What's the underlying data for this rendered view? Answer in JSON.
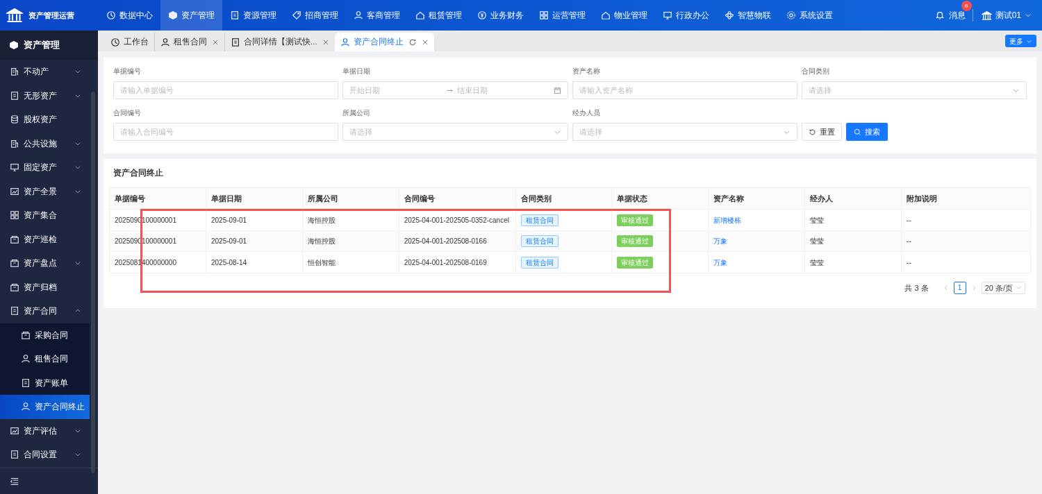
{
  "app": {
    "title": "资产管理运营"
  },
  "top_nav": [
    {
      "label": "数据中心",
      "selected": false
    },
    {
      "label": "资产管理",
      "selected": true
    },
    {
      "label": "资源管理",
      "selected": false
    },
    {
      "label": "招商管理",
      "selected": false
    },
    {
      "label": "客商管理",
      "selected": false
    },
    {
      "label": "租赁管理",
      "selected": false
    },
    {
      "label": "业务财务",
      "selected": false
    },
    {
      "label": "运营管理",
      "selected": false
    },
    {
      "label": "物业管理",
      "selected": false
    },
    {
      "label": "行政办公",
      "selected": false
    },
    {
      "label": "智慧物联",
      "selected": false
    },
    {
      "label": "系统设置",
      "selected": false
    }
  ],
  "header_right": {
    "messages": "消息",
    "message_count": "6",
    "user": "测试01"
  },
  "sidebar": {
    "title": "资产管理",
    "items": [
      {
        "label": "不动产",
        "kind": "group",
        "expanded": false,
        "selected": false
      },
      {
        "label": "无形资产",
        "kind": "group",
        "expanded": false,
        "selected": false
      },
      {
        "label": "股权资产",
        "kind": "link",
        "selected": false
      },
      {
        "label": "公共设施",
        "kind": "group",
        "expanded": false,
        "selected": false
      },
      {
        "label": "固定资产",
        "kind": "group",
        "expanded": false,
        "selected": false
      },
      {
        "label": "资产全景",
        "kind": "group",
        "expanded": false,
        "selected": false
      },
      {
        "label": "资产集合",
        "kind": "link",
        "selected": false
      },
      {
        "label": "资产巡检",
        "kind": "link",
        "selected": false
      },
      {
        "label": "资产盘点",
        "kind": "group",
        "expanded": false,
        "selected": false
      },
      {
        "label": "资产归档",
        "kind": "link",
        "selected": false
      },
      {
        "label": "资产合同",
        "kind": "group",
        "expanded": true,
        "selected": false,
        "children": [
          {
            "label": "采购合同",
            "selected": false
          },
          {
            "label": "租售合同",
            "selected": false
          },
          {
            "label": "资产账单",
            "selected": false
          },
          {
            "label": "资产合同终止",
            "selected": true
          }
        ]
      },
      {
        "label": "资产评估",
        "kind": "group",
        "expanded": false,
        "selected": false
      },
      {
        "label": "合同设置",
        "kind": "group",
        "expanded": false,
        "selected": false
      }
    ]
  },
  "tabs": [
    {
      "label": "工作台",
      "selected": false,
      "closable": false
    },
    {
      "label": "租售合同",
      "selected": false,
      "closable": true
    },
    {
      "label": "合同详情【测试快...",
      "selected": false,
      "closable": true
    },
    {
      "label": "资产合同终止",
      "selected": true,
      "closable": true
    }
  ],
  "more_button": "更多",
  "filters": [
    {
      "label": "单据编号",
      "kind": "text",
      "placeholder": "请输入单据编号"
    },
    {
      "label": "单据日期",
      "kind": "daterange",
      "placeholder": "开始日期",
      "placeholder_end": "结束日期"
    },
    {
      "label": "资产名称",
      "kind": "text",
      "placeholder": "请输入资产名称"
    },
    {
      "label": "合同类别",
      "kind": "select",
      "placeholder": "请选择"
    },
    {
      "label": "合同编号",
      "kind": "text",
      "placeholder": "请输入合同编号"
    },
    {
      "label": "所属公司",
      "kind": "select",
      "placeholder": "请选择"
    },
    {
      "label": "经办人员",
      "kind": "select",
      "placeholder": "请选择"
    }
  ],
  "buttons": {
    "reset": "重置",
    "search": "搜索"
  },
  "table": {
    "title": "资产合同终止",
    "columns": [
      "单据编号",
      "单据日期",
      "所属公司",
      "合同编号",
      "合同类别",
      "单据状态",
      "资产名称",
      "经办人",
      "附加说明"
    ],
    "rows": [
      [
        "2025090100000001",
        "2025-09-01",
        "海恒控股",
        "2025-04-001-202505-0352-cancel",
        "租赁合同",
        "审核通过",
        "新增楼栋",
        "莹莹",
        "--"
      ],
      [
        "2025090100000001",
        "2025-09-01",
        "海恒控股",
        "2025-04-001-202508-0166",
        "租赁合同",
        "审核通过",
        "万象",
        "莹莹",
        "--"
      ],
      [
        "2025081400000000",
        "2025-08-14",
        "恒创智能",
        "2025-04-001-202508-0169",
        "租赁合同",
        "审核通过",
        "万象",
        "莹莹",
        "--"
      ]
    ]
  },
  "pagination": {
    "total": "共 3 条",
    "pages": [
      {
        "label": "1",
        "selected": true
      }
    ],
    "page_size": "20 条/页"
  },
  "annotation": {
    "kind": "rectangle",
    "color": "#f05454"
  }
}
